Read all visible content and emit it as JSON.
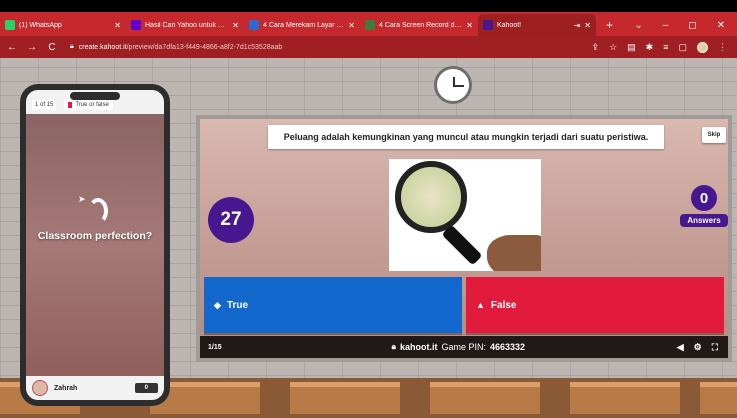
{
  "browser": {
    "tabs": [
      {
        "title": "(1) WhatsApp",
        "favicon_color": "#25d366",
        "active": false
      },
      {
        "title": "Hasil Cari Yahoo untuk cara r",
        "favicon_color": "#6001d2",
        "active": false
      },
      {
        "title": "4 Cara Merekam Layar Laptop",
        "favicon_color": "#2a6bd1",
        "active": false
      },
      {
        "title": "4 Cara Screen Record di Lapt",
        "favicon_color": "#3c7d3a",
        "active": false
      },
      {
        "title": "Kahoot!",
        "favicon_color": "#46178f",
        "active": true
      }
    ],
    "new_tab": "+",
    "url_host": "create.kahoot.it",
    "url_path": "/preview/da7dfa13-f449-4866-a8f2-7d1c53528aab"
  },
  "game": {
    "question": "Peluang adalah kemungkinan yang muncul atau mungkin terjadi dari suatu peristiwa.",
    "skip_label": "Skip",
    "timer": "27",
    "answers_count": "0",
    "answers_label": "Answers",
    "true_label": "True",
    "false_label": "False",
    "progress": "1/15",
    "site": "kahoot.it",
    "pin_label": "Game PIN:",
    "pin": "4663332"
  },
  "phone": {
    "question_counter": "1 of 15",
    "question_type": "True or false",
    "status_text": "Classroom perfection?",
    "player_name": "Zahrah",
    "score": "0"
  },
  "colors": {
    "chrome_red": "#c5292d",
    "kahoot_purple": "#46178f",
    "true_blue": "#1368ce",
    "false_red": "#e21b3c"
  }
}
